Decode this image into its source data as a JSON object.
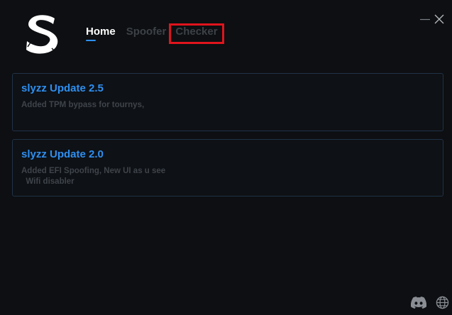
{
  "app": {
    "logo_letter": "S"
  },
  "nav": {
    "tabs": [
      {
        "label": "Home"
      },
      {
        "label": "Spoofer"
      },
      {
        "label": "Checker"
      }
    ]
  },
  "updates": [
    {
      "title": "slyzz Update 2.5",
      "body": "Added TPM bypass for tournys,"
    },
    {
      "title": "slyzz Update 2.0",
      "body": "Added EFI Spoofing, New UI as u see\n  Wifi disabler"
    }
  ],
  "colors": {
    "background": "#0d0f12",
    "accent": "#2e8ff0",
    "card_border": "#1f3247",
    "inactive_text": "#3d4248",
    "highlight_box": "#e0141c"
  },
  "icons": {
    "minimize": "minimize-icon",
    "close": "close-icon",
    "discord": "discord-icon",
    "website": "globe-icon"
  }
}
